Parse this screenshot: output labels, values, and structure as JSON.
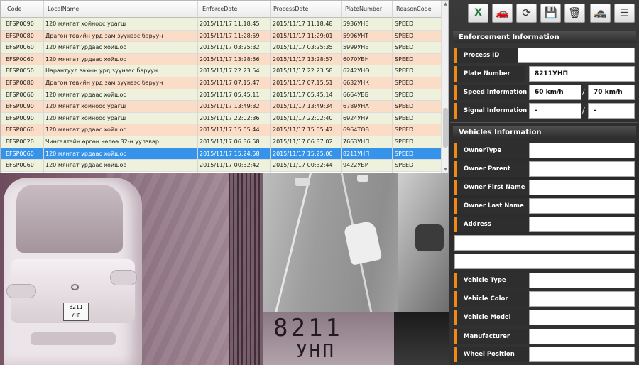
{
  "table": {
    "columns": [
      "Code",
      "LocalName",
      "EnforceDate",
      "ProcessDate",
      "PlateNumber",
      "ReasonCode"
    ],
    "rows": [
      {
        "code": "EFSP0090",
        "local_name": "120 мянгат хойноос урагш",
        "enforce_date": "2015/11/17 11:18:45",
        "process_date": "2015/11/17 11:18:48",
        "plate": "5936УНЕ",
        "reason": "SPEED",
        "style": "green"
      },
      {
        "code": "EFSP0080",
        "local_name": "Драгон төвийн урд зам зүүнээс баруун",
        "enforce_date": "2015/11/17 11:28:59",
        "process_date": "2015/11/17 11:29:01",
        "plate": "5996УНТ",
        "reason": "SPEED",
        "style": "orange"
      },
      {
        "code": "EFSP0060",
        "local_name": "120 мянгат урдаас хойшоо",
        "enforce_date": "2015/11/17 03:25:32",
        "process_date": "2015/11/17 03:25:35",
        "plate": "5999УНЕ",
        "reason": "SPEED",
        "style": "green"
      },
      {
        "code": "EFSP0060",
        "local_name": "120 мянгат урдаас хойшоо",
        "enforce_date": "2015/11/17 13:28:56",
        "process_date": "2015/11/17 13:28:57",
        "plate": "6070УБН",
        "reason": "SPEED",
        "style": "orange"
      },
      {
        "code": "EFSP0050",
        "local_name": "Нарантуул захын урд зүүнээс баруун",
        "enforce_date": "2015/11/17 22:23:54",
        "process_date": "2015/11/17 22:23:58",
        "plate": "6242УНӨ",
        "reason": "SPEED",
        "style": "green"
      },
      {
        "code": "EFSP0080",
        "local_name": "Драгон төвийн урд зам зүүнээс баруун",
        "enforce_date": "2015/11/17 07:15:47",
        "process_date": "2015/11/17 07:15:51",
        "plate": "6632УНК",
        "reason": "SPEED",
        "style": "orange"
      },
      {
        "code": "EFSP0060",
        "local_name": "120 мянгат урдаас хойшоо",
        "enforce_date": "2015/11/17 05:45:11",
        "process_date": "2015/11/17 05:45:14",
        "plate": "6664УББ",
        "reason": "SPEED",
        "style": "green"
      },
      {
        "code": "EFSP0090",
        "local_name": "120 мянгат хойноос урагш",
        "enforce_date": "2015/11/17 13:49:32",
        "process_date": "2015/11/17 13:49:34",
        "plate": "6789УНА",
        "reason": "SPEED",
        "style": "orange"
      },
      {
        "code": "EFSP0090",
        "local_name": "120 мянгат хойноос урагш",
        "enforce_date": "2015/11/17 22:02:36",
        "process_date": "2015/11/17 22:02:40",
        "plate": "6924УНУ",
        "reason": "SPEED",
        "style": "green"
      },
      {
        "code": "EFSP0060",
        "local_name": "120 мянгат урдаас хойшоо",
        "enforce_date": "2015/11/17 15:55:44",
        "process_date": "2015/11/17 15:55:47",
        "plate": "6964ТӨВ",
        "reason": "SPEED",
        "style": "orange"
      },
      {
        "code": "EFSP0020",
        "local_name": "Чингэлтэйн өргөн чөлөө 32-н уулзвар",
        "enforce_date": "2015/11/17 06:36:58",
        "process_date": "2015/11/17 06:37:02",
        "plate": "7663УНП",
        "reason": "SPEED",
        "style": "green"
      },
      {
        "code": "EFSP0060",
        "local_name": "120 мянгат урдаас хойшоо",
        "enforce_date": "2015/11/17 15:24:58",
        "process_date": "2015/11/17 15:25:00",
        "plate": "8211УНП",
        "reason": "SPEED",
        "style": "sel"
      },
      {
        "code": "EFSP0060",
        "local_name": "120 мянгат урдаас хойшоо",
        "enforce_date": "2015/11/17 00:32:42",
        "process_date": "2015/11/17 00:32:44",
        "plate": "9422УБИ",
        "reason": "SPEED",
        "style": "green"
      }
    ]
  },
  "camera": {
    "plate_number": "8211",
    "plate_letters": "УНП"
  },
  "toolbar": {
    "buttons": [
      {
        "name": "excel-export-button",
        "icon": "excel-icon",
        "glyph": "X"
      },
      {
        "name": "vehicle-button",
        "icon": "car-icon",
        "glyph": "🚗"
      },
      {
        "name": "refresh-button",
        "icon": "refresh-icon",
        "glyph": "⟳"
      },
      {
        "name": "save-button",
        "icon": "save-icon",
        "glyph": "💾"
      },
      {
        "name": "delete-button",
        "icon": "trash-icon",
        "glyph": "🗑"
      },
      {
        "name": "police-car-button",
        "icon": "police-car-icon",
        "glyph": "🚓"
      },
      {
        "name": "list-button",
        "icon": "list-icon",
        "glyph": "☰"
      }
    ]
  },
  "enforcement": {
    "title": "Enforcement Information",
    "process_id_label": "Process ID",
    "process_id": "",
    "plate_label": "Plate Number",
    "plate": "8211УНП",
    "speed_label": "Speed Information",
    "speed": "60 km/h",
    "speed_limit": "70 km/h",
    "signal_label": "Signal Information",
    "signal_a": "-",
    "signal_b": "-"
  },
  "vehicles": {
    "title": "Vehicles Information",
    "owner_type_label": "OwnerType",
    "owner_parent_label": "Owner Parent Name",
    "owner_first_label": "Owner First Name",
    "owner_last_label": "Owner Last Name",
    "address_label": "Address",
    "vehicle_type_label": "Vehicle Type",
    "vehicle_color_label": "Vehicle Color",
    "vehicle_model_label": "Vehicle Model",
    "manufacturer_label": "Manufacturer",
    "wheel_position_label": "Wheel Position"
  },
  "colors": {
    "row_green": "#eef1dc",
    "row_orange": "#fbdcc6",
    "row_selected": "#3593ea",
    "accent": "#f08a14"
  }
}
